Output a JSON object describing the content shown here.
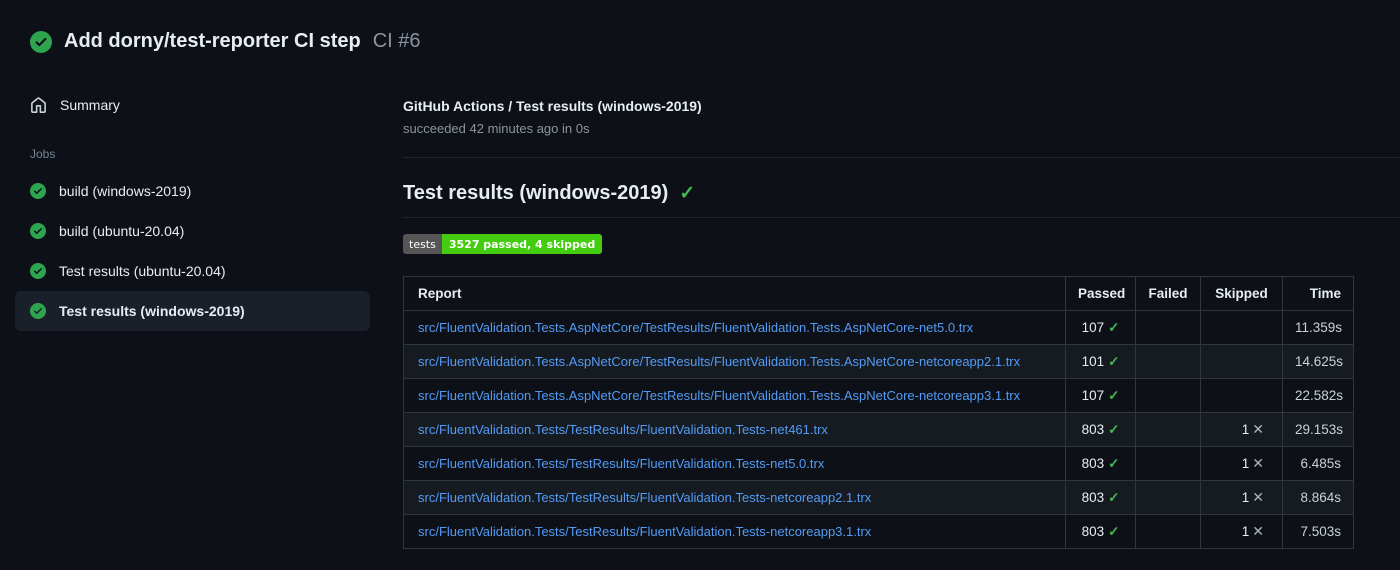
{
  "run_header": {
    "title": "Add dorny/test-reporter CI step",
    "run_number": "CI #6"
  },
  "sidebar": {
    "summary_label": "Summary",
    "jobs_label": "Jobs",
    "jobs": [
      {
        "label": "build (windows-2019)",
        "status": "success",
        "selected": false
      },
      {
        "label": "build (ubuntu-20.04)",
        "status": "success",
        "selected": false
      },
      {
        "label": "Test results (ubuntu-20.04)",
        "status": "success",
        "selected": false
      },
      {
        "label": "Test results (windows-2019)",
        "status": "success",
        "selected": true
      }
    ]
  },
  "job_header": {
    "title": "GitHub Actions / Test results (windows-2019)",
    "subtitle": "succeeded 42 minutes ago in 0s"
  },
  "section": {
    "title": "Test results (windows-2019)",
    "status_glyph": "✓",
    "badge": {
      "label": "tests",
      "value": "3527 passed, 4 skipped",
      "label_bg": "#555555",
      "value_bg": "#44cc11"
    }
  },
  "table": {
    "headers": [
      "Report",
      "Passed",
      "Failed",
      "Skipped",
      "Time"
    ],
    "pass_glyph": "✓",
    "skip_glyph": "✕",
    "rows": [
      {
        "report": "src/FluentValidation.Tests.AspNetCore/TestResults/FluentValidation.Tests.AspNetCore-net5.0.trx",
        "passed": "107",
        "failed": "",
        "skipped": "",
        "time": "11.359s"
      },
      {
        "report": "src/FluentValidation.Tests.AspNetCore/TestResults/FluentValidation.Tests.AspNetCore-netcoreapp2.1.trx",
        "passed": "101",
        "failed": "",
        "skipped": "",
        "time": "14.625s"
      },
      {
        "report": "src/FluentValidation.Tests.AspNetCore/TestResults/FluentValidation.Tests.AspNetCore-netcoreapp3.1.trx",
        "passed": "107",
        "failed": "",
        "skipped": "",
        "time": "22.582s"
      },
      {
        "report": "src/FluentValidation.Tests/TestResults/FluentValidation.Tests-net461.trx",
        "passed": "803",
        "failed": "",
        "skipped": "1",
        "time": "29.153s"
      },
      {
        "report": "src/FluentValidation.Tests/TestResults/FluentValidation.Tests-net5.0.trx",
        "passed": "803",
        "failed": "",
        "skipped": "1",
        "time": "6.485s"
      },
      {
        "report": "src/FluentValidation.Tests/TestResults/FluentValidation.Tests-netcoreapp2.1.trx",
        "passed": "803",
        "failed": "",
        "skipped": "1",
        "time": "8.864s"
      },
      {
        "report": "src/FluentValidation.Tests/TestResults/FluentValidation.Tests-netcoreapp3.1.trx",
        "passed": "803",
        "failed": "",
        "skipped": "1",
        "time": "7.503s"
      }
    ]
  },
  "colors": {
    "success_green": "#3fb950",
    "icon_green": "#2ea44f",
    "link_blue": "#539bf5",
    "page_bg": "#0d1117"
  }
}
